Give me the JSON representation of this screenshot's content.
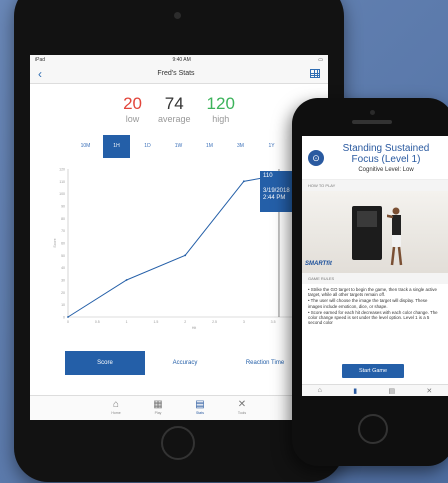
{
  "ipad": {
    "status": {
      "left": "iPad",
      "time": "9:40 AM"
    },
    "nav": {
      "back_icon": "chevron-left-icon",
      "title": "Fred's Stats",
      "grid_icon": "table-grid-icon"
    },
    "summary": [
      {
        "value": "20",
        "label": "low",
        "color": "#e2453b"
      },
      {
        "value": "74",
        "label": "average",
        "color": "#333333"
      },
      {
        "value": "120",
        "label": "high",
        "color": "#3cb35b"
      }
    ],
    "ranges": [
      "10M",
      "1H",
      "1D",
      "1W",
      "1M",
      "3M",
      "1Y",
      "5Y"
    ],
    "active_range": "1H",
    "tooltip": {
      "value": "110",
      "date": "3/19/2018",
      "time": "2:44 PM"
    },
    "metrics": [
      "Score",
      "Accuracy",
      "Reaction Time"
    ],
    "active_metric": "Score",
    "tabs": [
      {
        "label": "Home",
        "icon": "home-icon"
      },
      {
        "label": "Play",
        "icon": "play-icon"
      },
      {
        "label": "Stats",
        "icon": "stats-icon"
      },
      {
        "label": "Tools",
        "icon": "tools-icon"
      }
    ],
    "active_tab": "Stats"
  },
  "chart_data": {
    "type": "line",
    "x": [
      0,
      1,
      2,
      3,
      3.6,
      4
    ],
    "y": [
      0,
      30,
      50,
      110,
      115,
      120
    ],
    "xlim": [
      0,
      4.3
    ],
    "ylim": [
      0,
      120
    ],
    "yticks": [
      0,
      10,
      20,
      30,
      40,
      50,
      60,
      70,
      80,
      90,
      100,
      110,
      120
    ],
    "xticks": [
      "0",
      "0.5",
      "1",
      "1.5",
      "2",
      "2.5",
      "3",
      "3.5",
      "4"
    ],
    "ylabel": "Score",
    "xlabel": "Hit",
    "highlight_x": 3.6,
    "grid": false
  },
  "iphone": {
    "title": "Standing Sustained Focus (Level 1)",
    "subtitle": "Cognitive Level: Low",
    "logo_icon": "target-icon",
    "how_to_play": "HOW TO PLAY",
    "brand": "SMARTfit",
    "game_rules_label": "GAME RULES",
    "rules": [
      "• Strike the GO target to begin the game, then track a single active target, while all other targets remain off.",
      "• The user will choose the image the target will display. These images include emoticon, dice, or shape.",
      "• Score earned for each hit decreases with each color change. The color change speed is set under the level option. Level 1 is a 5 second color"
    ],
    "start_button": "Start Game",
    "tabs": [
      "home-icon",
      "play-icon",
      "stats-icon",
      "tools-icon"
    ]
  }
}
